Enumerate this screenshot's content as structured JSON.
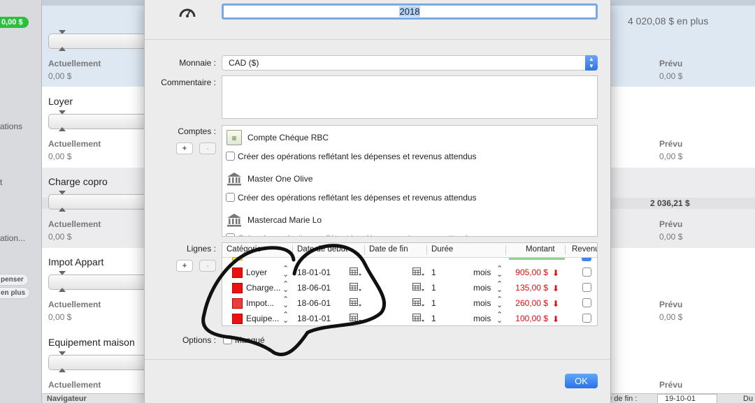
{
  "sidebar": {
    "badge": "0,00 $",
    "texts": [
      "ations",
      "t",
      "ation..."
    ],
    "pills": [
      "penser",
      "en plus"
    ]
  },
  "background": {
    "header_right": "4 020,08 $ en plus",
    "actual_label": "Actuellement",
    "expected_label": "Prévu",
    "zero": "0,00 $",
    "categories": [
      {
        "title": "",
        "actual": "0,00 $",
        "expected": "0,00 $"
      },
      {
        "title": "Loyer",
        "actual": "0,00 $",
        "expected": "0,00 $"
      },
      {
        "title": "Charge copro",
        "actual": "0,00 $",
        "expected": "0,00 $",
        "summary": "2 036,21 $"
      },
      {
        "title": "Impot Appart",
        "actual": "0,00 $",
        "expected": "0,00 $"
      },
      {
        "title": "Equipement maison",
        "actual": "",
        "expected": ""
      }
    ],
    "footer_left": "Navigateur",
    "footer_date_label": "ate de fin :",
    "footer_date": "19-10-01",
    "footer_du": "Du"
  },
  "sheet": {
    "year": "2018",
    "labels": {
      "currency": "Monnaie :",
      "comment": "Commentaire :",
      "accounts": "Comptes :",
      "lines": "Lignes :",
      "options": "Options :"
    },
    "currency_value": "CAD ($)",
    "accounts": [
      {
        "name": "Compte Chéque RBC",
        "icon": "cheque-icon"
      },
      {
        "name": "Master One Olive",
        "icon": "bank-icon"
      },
      {
        "name": "Mastercad Marie Lo",
        "icon": "bank-icon"
      }
    ],
    "create_ops_label": "Créer des opérations reflétant les dépenses et revenus attendus",
    "plus": "+",
    "minus": "-",
    "table": {
      "columns": [
        "Catégorie",
        "Date de début",
        "Date de fin",
        "Durée",
        "Montant",
        "Revenu"
      ],
      "rows": [
        {
          "category": "Loyer",
          "start": "18-01-01",
          "end": "",
          "duration": "1",
          "unit": "mois",
          "amount": "905,00 $",
          "color": "#ee0f0f"
        },
        {
          "category": "Charge...",
          "start": "18-06-01",
          "end": "",
          "duration": "1",
          "unit": "mois",
          "amount": "135,00 $",
          "color": "#ee0f0f"
        },
        {
          "category": "Impot...",
          "start": "18-06-01",
          "end": "",
          "duration": "1",
          "unit": "mois",
          "amount": "260,00 $",
          "color": "#ee3b3b"
        },
        {
          "category": "Equipe...",
          "start": "18-01-01",
          "end": "",
          "duration": "1",
          "unit": "mois",
          "amount": "100,00 $",
          "color": "#ee0f0f"
        }
      ]
    },
    "options_checkbox": "Masqué",
    "ok": "OK"
  }
}
